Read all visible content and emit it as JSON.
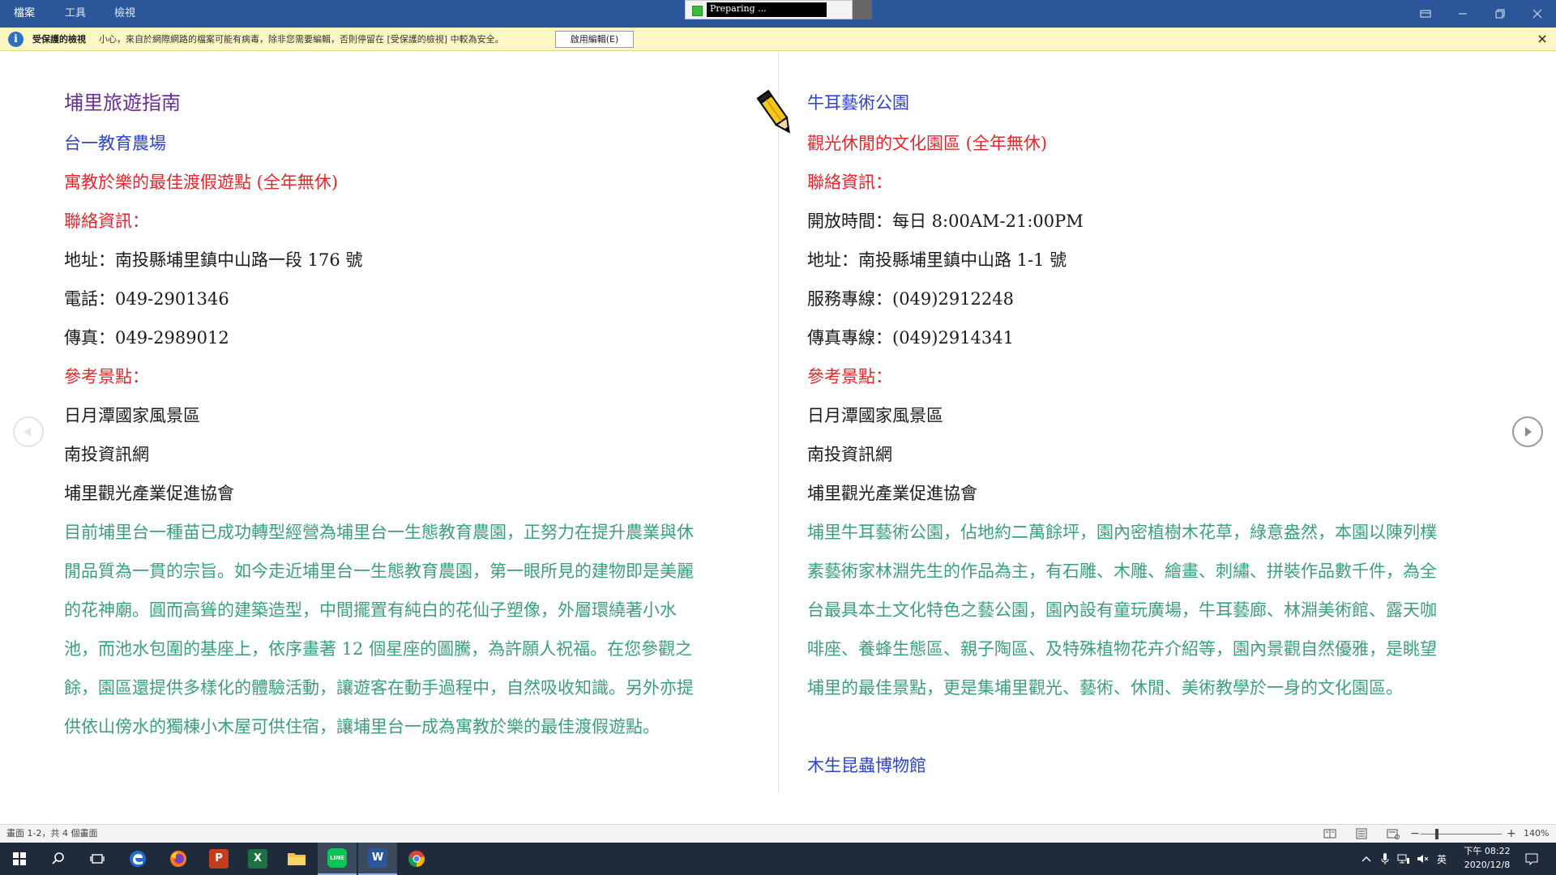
{
  "titlebar": {
    "menu": [
      "檔案",
      "工具",
      "檢視"
    ],
    "progress_label": "Preparing ...",
    "colors": {
      "background": "#2b579a"
    }
  },
  "protected_view": {
    "title": "受保護的檢視",
    "message": "小心，來自於網際網路的檔案可能有病毒，除非您需要編輯，否則停留在 [受保護的檢視] 中較為安全。",
    "enable_button": "啟用編輯(E)",
    "colors": {
      "background": "#fdf7c3"
    }
  },
  "document": {
    "left": {
      "title": "埔里旅遊指南",
      "place_name": "台一教育農場",
      "tagline": "寓教於樂的最佳渡假遊點 (全年無休)",
      "contact_header": "聯絡資訊：",
      "address": "地址：南投縣埔里鎮中山路一段 176 號",
      "phone": "電話：049-2901346",
      "fax": "傳真：049-2989012",
      "ref_header": "參考景點：",
      "refs": [
        "日月潭國家風景區",
        "南投資訊網",
        "埔里觀光產業促進協會"
      ],
      "description_lines": [
        "目前埔里台一種苗已成功轉型經營為埔里台一生態教育農園，正努力在提升農業與休",
        "閒品質為一貫的宗旨。如今走近埔里台一生態教育農園，第一眼所見的建物即是美麗",
        "的花神廟。圓而高聳的建築造型，中間擺置有純白的花仙子塑像，外層環繞著小水",
        "池，而池水包圍的基座上，依序畫著 12 個星座的圖騰，為許願人祝福。在您參觀之",
        "餘，園區還提供多樣化的體驗活動，讓遊客在動手過程中，自然吸收知識。另外亦提",
        "供依山傍水的獨棟小木屋可供住宿，讓埔里台一成為寓教於樂的最佳渡假遊點。"
      ]
    },
    "right": {
      "place_name": "牛耳藝術公園",
      "tagline": "觀光休閒的文化園區 (全年無休)",
      "contact_header": "聯絡資訊：",
      "hours": "開放時間：每日 8:00AM-21:00PM",
      "address": "地址：南投縣埔里鎮中山路 1-1 號",
      "service_line": "服務專線：(049)2912248",
      "fax_line": "傳真專線：(049)2914341",
      "ref_header": "參考景點：",
      "refs": [
        "日月潭國家風景區",
        "南投資訊網",
        "埔里觀光產業促進協會"
      ],
      "description_lines": [
        "埔里牛耳藝術公園，佔地約二萬餘坪，園內密植樹木花草，綠意盎然，本園以陳列樸",
        "素藝術家林淵先生的作品為主，有石雕、木雕、繪畫、刺繡、拼裝作品數千件，為全",
        "台最具本土文化特色之藝公園，園內設有童玩廣場，牛耳藝廊、林淵美術館、露天咖",
        "啡座、養蜂生態區、親子陶區、及特殊植物花卉介紹等，園內景觀自然優雅，是眺望",
        "埔里的最佳景點，更是集埔里觀光、藝術、休閒、美術教學於一身的文化園區。"
      ],
      "next_place": "木生昆蟲博物館"
    },
    "colors": {
      "title": "#6a2e9c",
      "heading": "#2e43c9",
      "accent": "#e3262c",
      "body": "#1a1a1a",
      "description": "#3aa07a"
    }
  },
  "statusbar": {
    "page_info": "畫面 1-2，共 4 個畫面",
    "zoom": "140%",
    "zoom_minus": "−",
    "zoom_plus": "+"
  },
  "taskbar": {
    "apps": [
      "start-icon",
      "search-icon",
      "task-view-icon",
      "edge-icon",
      "firefox-icon",
      "powerpoint-icon",
      "excel-icon",
      "file-explorer-icon",
      "line-icon",
      "word-icon",
      "chrome-icon"
    ],
    "app_letters": {
      "powerpoint": "P",
      "excel": "X",
      "word": "W",
      "line": "LINE"
    },
    "ime": "英",
    "time": "下午 08:22",
    "date": "2020/12/8"
  }
}
